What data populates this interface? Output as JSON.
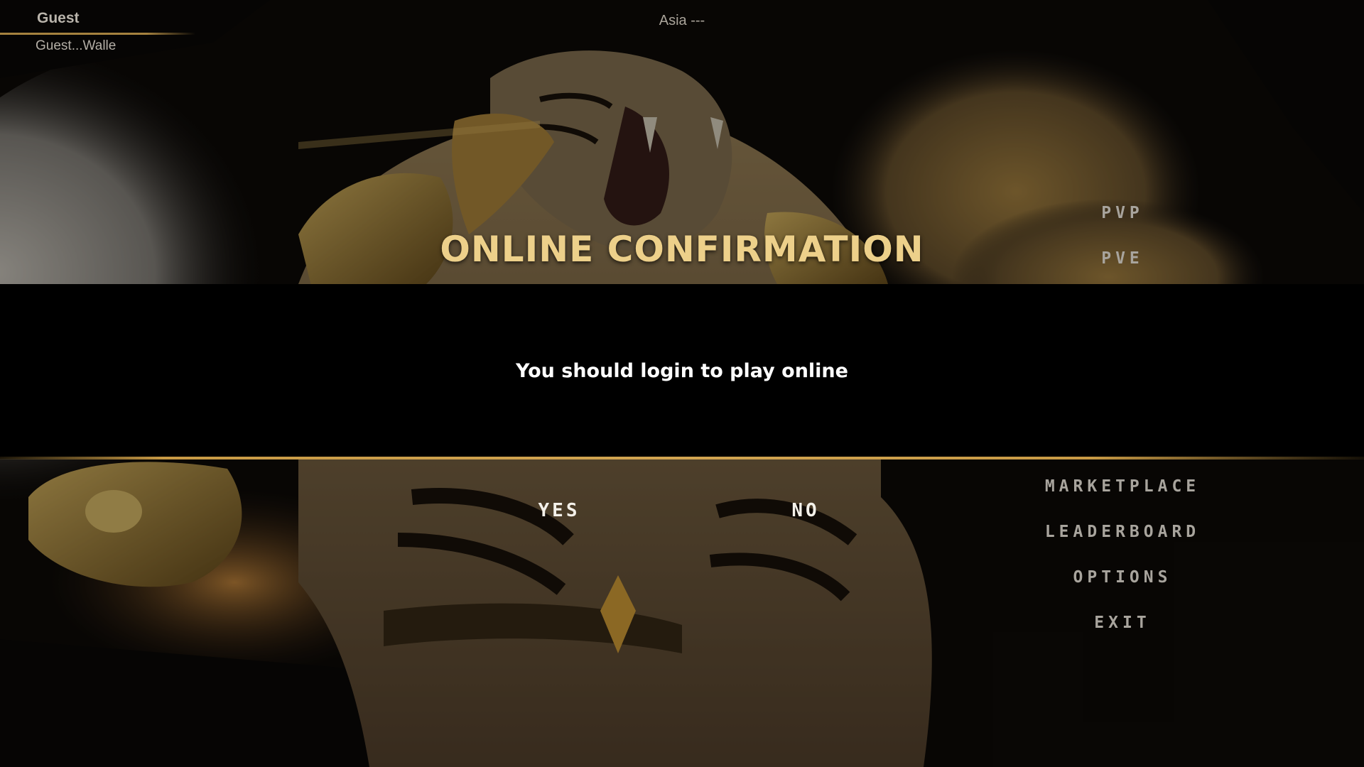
{
  "player": {
    "name": "Guest",
    "wallet": "Guest...Walle"
  },
  "server": {
    "label": "Asia ---"
  },
  "menu": {
    "items": [
      {
        "label": "PVP"
      },
      {
        "label": "PVE"
      },
      {
        "label": "MARKETPLACE"
      },
      {
        "label": "LEADERBOARD"
      },
      {
        "label": "OPTIONS"
      },
      {
        "label": "EXIT"
      }
    ]
  },
  "dialog": {
    "title": "ONLINE CONFIRMATION",
    "message": "You should login to play online",
    "yes_label": "YES",
    "no_label": "NO"
  },
  "colors": {
    "accent_gold": "#d2a551",
    "title_gold": "#edd08a",
    "menu_text": "#a8a49d",
    "dialog_band": "#000000"
  }
}
